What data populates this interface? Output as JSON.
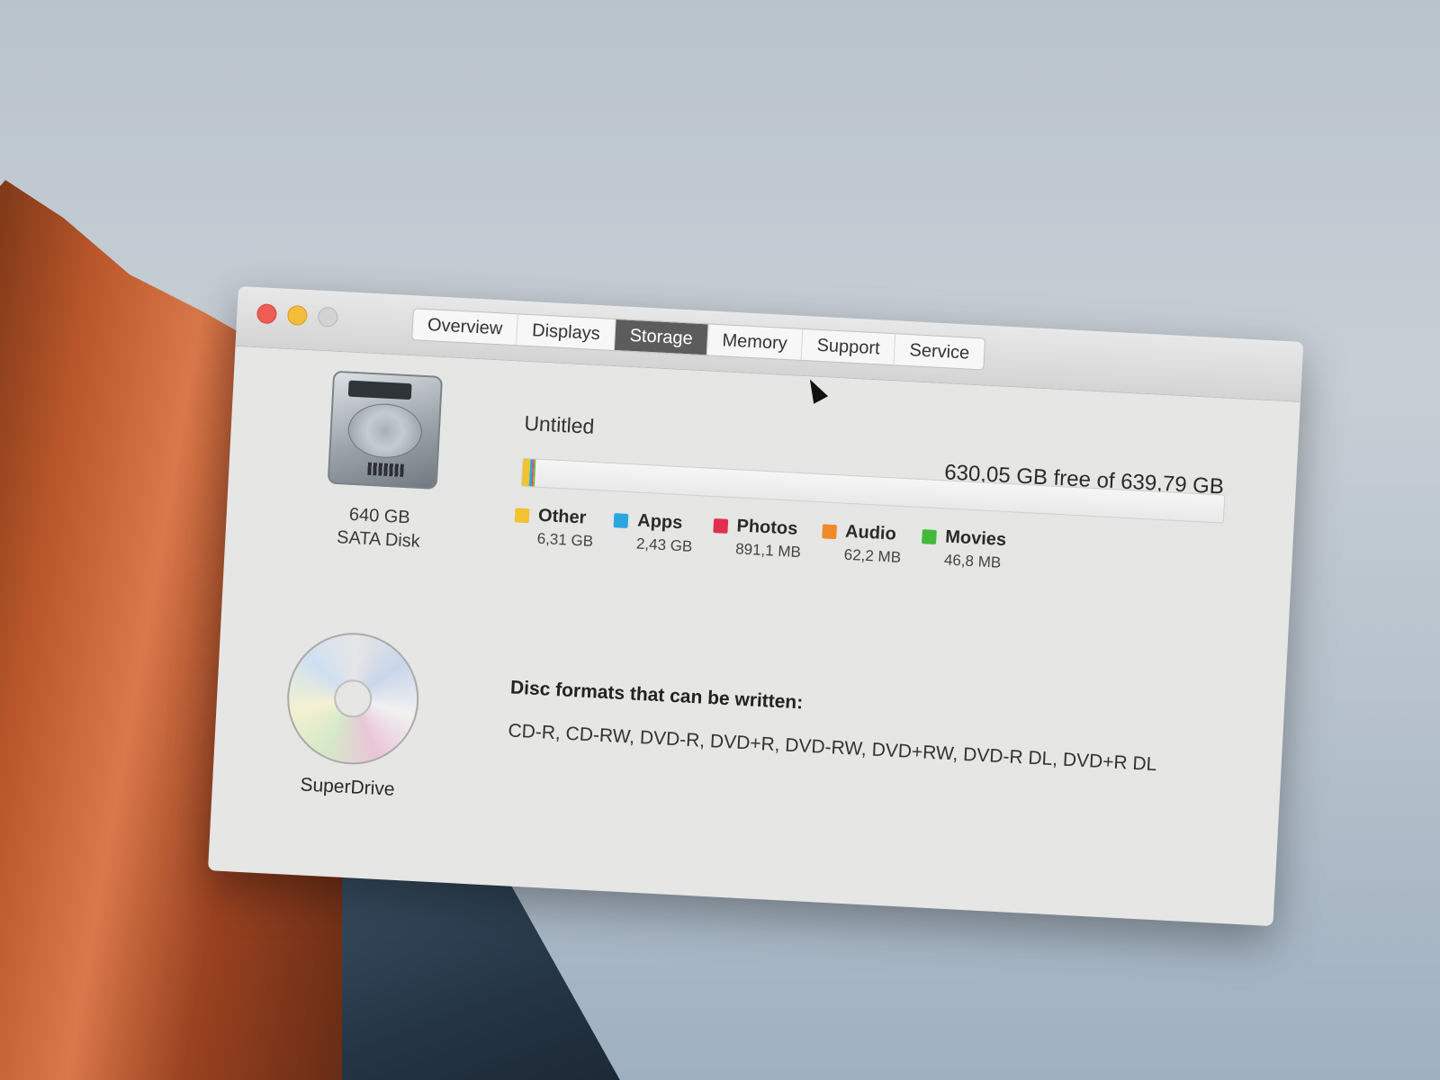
{
  "window": {
    "tabs": [
      {
        "label": "Overview"
      },
      {
        "label": "Displays"
      },
      {
        "label": "Storage"
      },
      {
        "label": "Memory"
      },
      {
        "label": "Support"
      },
      {
        "label": "Service"
      }
    ],
    "active_tab": "Storage"
  },
  "storage": {
    "disk": {
      "capacity": "640 GB",
      "type": "SATA Disk",
      "icon": "hard-disk-icon"
    },
    "volume_name": "Untitled",
    "free_text": "630,05 GB free of 639,79 GB",
    "total_gb": 639.79,
    "legend": [
      {
        "name": "Other",
        "size": "6,31 GB",
        "color": "#f2c230",
        "gb": 6.31
      },
      {
        "name": "Apps",
        "size": "2,43 GB",
        "color": "#2aa7e0",
        "gb": 2.43
      },
      {
        "name": "Photos",
        "size": "891,1 MB",
        "color": "#e0304d",
        "gb": 0.8911
      },
      {
        "name": "Audio",
        "size": "62,2 MB",
        "color": "#f08a2b",
        "gb": 0.0622
      },
      {
        "name": "Movies",
        "size": "46,8 MB",
        "color": "#43b93c",
        "gb": 0.0468
      }
    ]
  },
  "optical": {
    "name": "SuperDrive",
    "icon": "disc-icon",
    "formats_title": "Disc formats that can be written:",
    "formats": "CD-R, CD-RW, DVD-R, DVD+R, DVD-RW, DVD+RW, DVD-R DL, DVD+R DL"
  }
}
